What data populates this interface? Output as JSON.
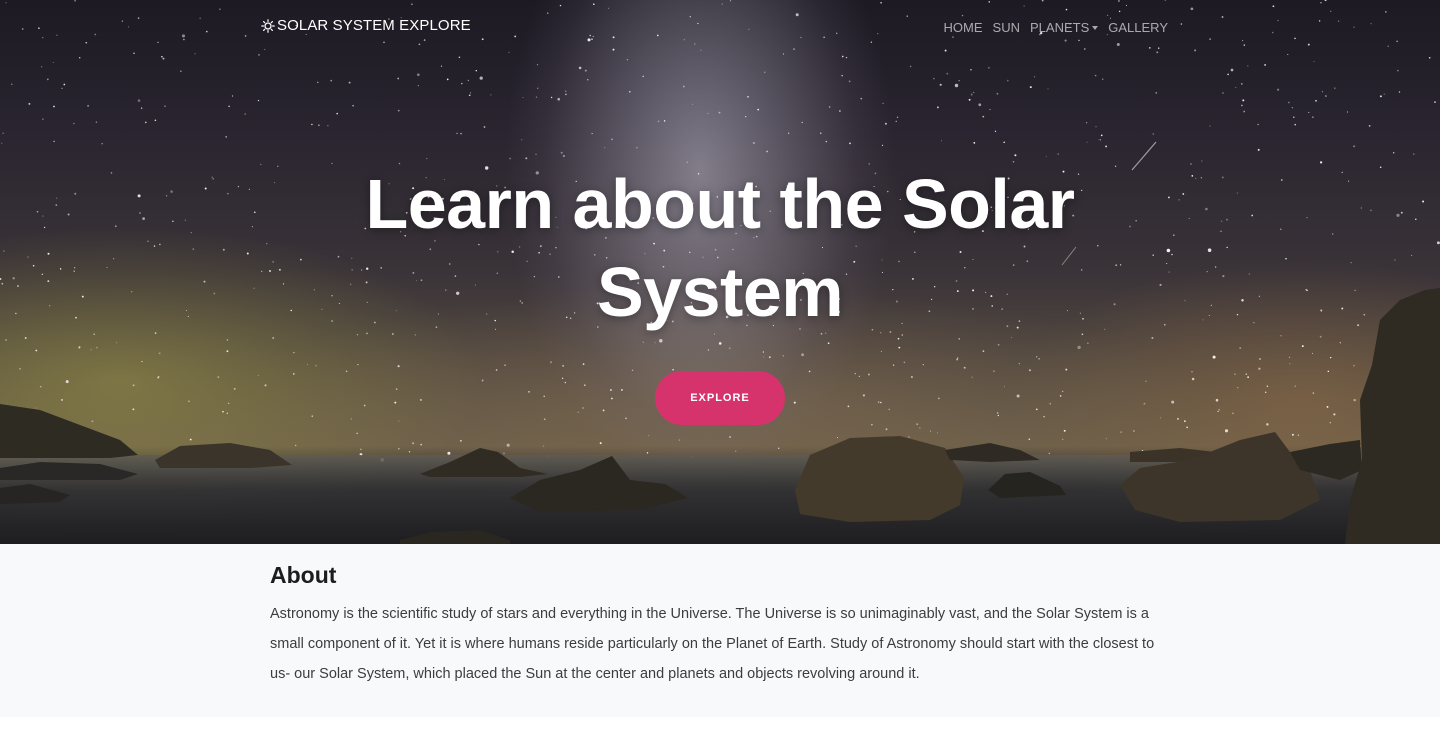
{
  "navbar": {
    "brand": "SOLAR SYSTEM EXPLORE",
    "brand_icon": "sun-icon",
    "links": [
      {
        "label": "HOME"
      },
      {
        "label": "SUN"
      },
      {
        "label": "PLANETS",
        "has_dropdown": true
      },
      {
        "label": "GALLERY"
      }
    ]
  },
  "hero": {
    "title_line1": "Learn about the Solar",
    "title_line2": "System",
    "button_label": "EXPLORE",
    "button_color": "#d6336c"
  },
  "about": {
    "heading": "About",
    "text": "Astronomy is the scientific study of stars and everything in the Universe. The Universe is so unimaginably vast, and the Solar System is a small component of it. Yet it is where humans reside particularly on the Planet of Earth. Study of Astronomy should start with the closest to us- our Solar System, which placed the Sun at the center and planets and objects revolving around it."
  }
}
